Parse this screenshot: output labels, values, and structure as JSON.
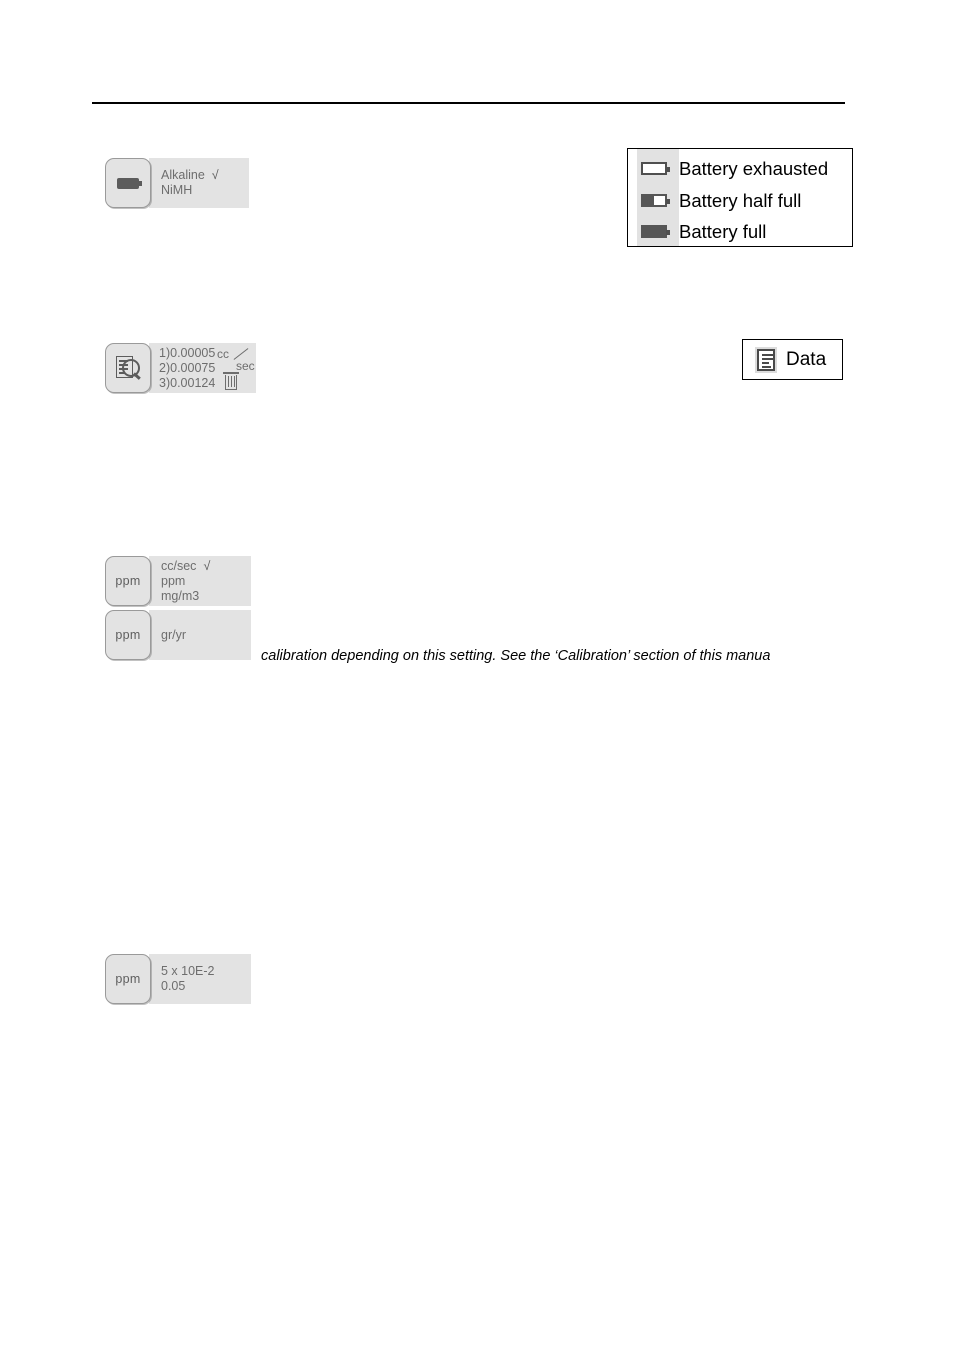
{
  "page": {
    "background": "#ffffff",
    "rule_color": "#000000"
  },
  "widgets": {
    "battery_type": {
      "key_label": "",
      "key_icon": "battery-icon",
      "lines": [
        "Alkaline",
        "NiMH"
      ],
      "checked_line": "Alkaline",
      "check_glyph": "√"
    },
    "data_log": {
      "key_icon": "document-magnifier-icon",
      "readings": [
        "1)0.00005",
        "2)0.00075",
        "3)0.00124"
      ],
      "unit_numerator": "cc",
      "unit_denominator": "sec",
      "trash_icon": "trash-icon"
    },
    "units_primary": {
      "key_label": "ppm",
      "lines": [
        "cc/sec",
        "ppm",
        "mg/m3"
      ],
      "checked_line": "cc/sec",
      "check_glyph": "√"
    },
    "units_secondary": {
      "key_label": "ppm",
      "lines": [
        "gr/yr"
      ]
    },
    "resolution": {
      "key_label": "ppm",
      "lines": [
        "5 x 10E-2",
        "0.05"
      ]
    }
  },
  "battery_legend": {
    "strip_color": "#e2e2e2",
    "border_color": "#000000",
    "rows": [
      {
        "label": "Battery exhausted",
        "state": "empty",
        "icon": "battery-empty-icon"
      },
      {
        "label": "Battery half full",
        "state": "half",
        "icon": "battery-half-icon"
      },
      {
        "label": "Battery full",
        "state": "full",
        "icon": "battery-full-icon"
      }
    ]
  },
  "data_button": {
    "label": "Data",
    "icon": "document-lines-icon"
  },
  "caption": {
    "text": "calibration depending on this setting. See the ‘Calibration’ section of this manua"
  }
}
